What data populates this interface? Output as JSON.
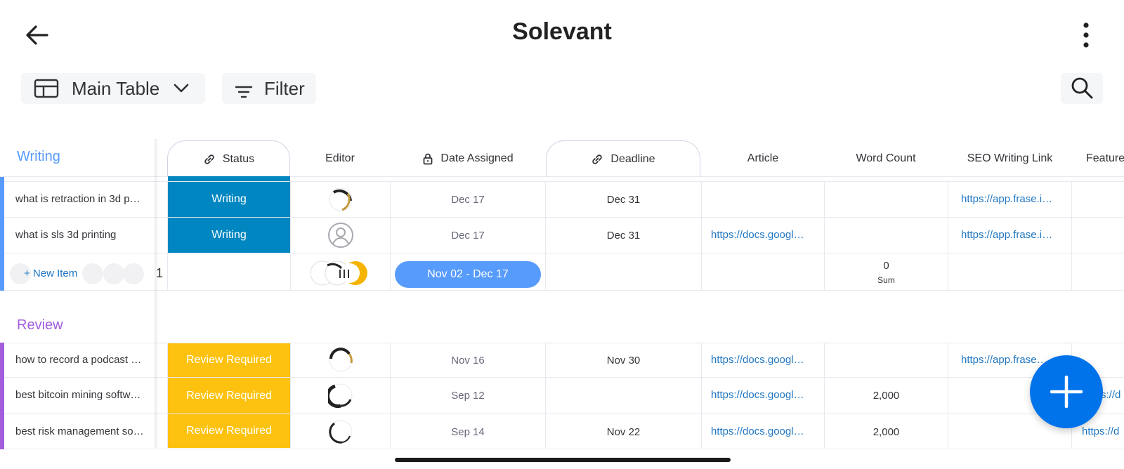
{
  "app": {
    "title": "Solevant"
  },
  "icons": {
    "back": "arrow-left-icon",
    "more": "more-vertical-icon",
    "table": "table-icon",
    "chevron": "chevron-down-icon",
    "filter": "filter-icon",
    "search": "search-icon",
    "link": "link-icon",
    "lock": "lock-icon",
    "add": "plus-icon"
  },
  "toolbar": {
    "view_label": "Main Table",
    "filter_label": "Filter"
  },
  "columns": {
    "status": "Status",
    "editor": "Editor",
    "date_assigned": "Date Assigned",
    "deadline": "Deadline",
    "article": "Article",
    "word_count": "Word Count",
    "seo_link": "SEO Writing Link",
    "feature": "Feature"
  },
  "colors": {
    "writing_group": "#579bfc",
    "review_group": "#a25ddc",
    "status_writing": "#0086c0",
    "status_review": "#fdc20f",
    "link": "#1f76c2",
    "fab": "#0073ea"
  },
  "groups": {
    "writing": {
      "title": "Writing",
      "rows": [
        {
          "name": "what is retraction in 3d p…",
          "status": "Writing",
          "date_assigned": "Dec 17",
          "deadline": "Dec 31",
          "article": "",
          "word_count": "",
          "seo_link": "https://app.frase.i…"
        },
        {
          "name": "what is sls 3d printing",
          "status": "Writing",
          "date_assigned": "Dec 17",
          "deadline": "Dec 31",
          "article": "https://docs.googl…",
          "word_count": "",
          "seo_link": "https://app.frase.i…"
        }
      ],
      "summary": {
        "new_item_label": "+ New Item",
        "count": "1",
        "date_range": "Nov 02 - Dec 17",
        "word_sum_value": "0",
        "word_sum_label": "Sum"
      }
    },
    "review": {
      "title": "Review",
      "rows": [
        {
          "name": "how to record a podcast …",
          "status": "Review Required",
          "date_assigned": "Nov 16",
          "deadline": "Nov 30",
          "article": "https://docs.googl…",
          "word_count": "",
          "seo_link": "https://app.frase…"
        },
        {
          "name": "best bitcoin mining softw…",
          "status": "Review Required",
          "date_assigned": "Sep 12",
          "deadline": "",
          "article": "https://docs.googl…",
          "word_count": "2,000",
          "seo_link": "",
          "feature_link": "https://d"
        },
        {
          "name": "best risk management so…",
          "status": "Review Required",
          "date_assigned": "Sep 14",
          "deadline": "Nov 22",
          "article": "https://docs.googl…",
          "word_count": "2,000",
          "seo_link": "",
          "feature_link": "https://d"
        }
      ]
    }
  }
}
